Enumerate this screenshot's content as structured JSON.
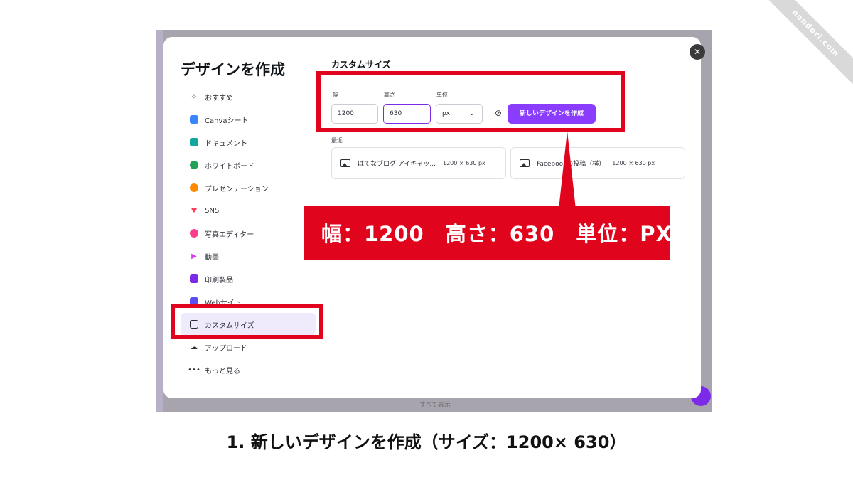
{
  "watermark": "nondori.com",
  "background": {
    "bottom_text": "すべて表示"
  },
  "modal": {
    "title": "デザインを作成",
    "close_icon": "close-icon",
    "nav_items": [
      {
        "label": "おすすめ",
        "icon": "sparkle-icon",
        "color": "#2b2f36"
      },
      {
        "label": "Canvaシート",
        "icon": "sheet-icon",
        "color": "#3a86ff"
      },
      {
        "label": "ドキュメント",
        "icon": "document-icon",
        "color": "#13a89e"
      },
      {
        "label": "ホワイトボード",
        "icon": "whiteboard-icon",
        "color": "#1fa35b"
      },
      {
        "label": "プレゼンテーション",
        "icon": "presentation-icon",
        "color": "#ff8a00"
      },
      {
        "label": "SNS",
        "icon": "heart-icon",
        "color": "#ff3b5c"
      },
      {
        "label": "写真エディター",
        "icon": "camera-icon",
        "color": "#ff3d8b"
      },
      {
        "label": "動画",
        "icon": "video-icon",
        "color": "#d63cf0"
      },
      {
        "label": "印刷製品",
        "icon": "printer-icon",
        "color": "#7d2ae8"
      },
      {
        "label": "Webサイト",
        "icon": "web-icon",
        "color": "#5b4df0"
      },
      {
        "label": "カスタムサイズ",
        "icon": "custom-size-icon",
        "color": "#2b2f36",
        "active": true
      },
      {
        "label": "アップロード",
        "icon": "upload-icon",
        "color": "#2b2f36"
      },
      {
        "label": "もっと見る",
        "icon": "more-icon",
        "color": "#2b2f36"
      }
    ],
    "custom_size": {
      "title": "カスタムサイズ",
      "width_label": "幅",
      "width_value": "1200",
      "height_label": "高さ",
      "height_value": "630",
      "unit_label": "単位",
      "unit_value": "px",
      "create_button": "新しいデザインを作成",
      "recent_label": "最近",
      "recent": [
        {
          "name": "はてなブログ アイキャッ...",
          "size": "1200 × 630 px"
        },
        {
          "name": "Facebookの投稿（横）",
          "size": "1200 × 630 px"
        }
      ]
    }
  },
  "annotation": {
    "callout_text": "幅：1200　高さ：630　単位：PX",
    "color": "#e0051c"
  },
  "caption": "1. 新しいデザインを作成（サイズ：1200× 630）"
}
